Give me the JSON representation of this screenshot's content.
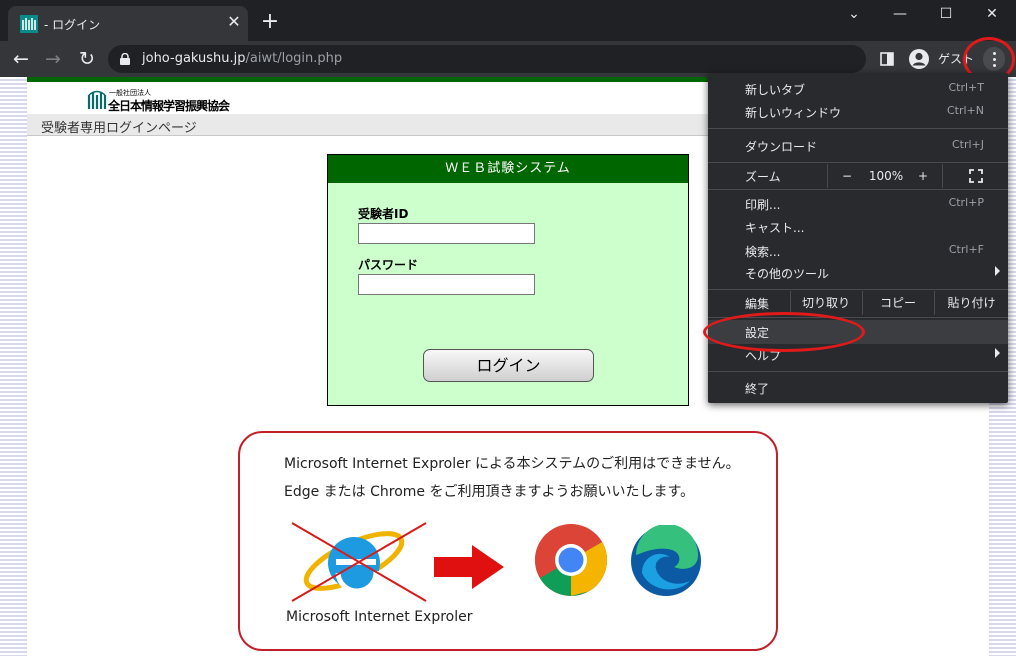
{
  "tab": {
    "title": "- ログイン",
    "close_glyph": "✕",
    "new_tab_glyph": "+"
  },
  "window_controls": {
    "minimize": "—",
    "maximize": "☐",
    "close": "✕",
    "dropdown": "⌄"
  },
  "toolbar": {
    "back_glyph": "←",
    "forward_glyph": "→",
    "reload_glyph": "↻",
    "url_domain": "joho-gakushu.jp",
    "url_path": "/aiwt/login.php",
    "profile_label": "ゲスト"
  },
  "page": {
    "logo_subtitle": "一般社団法人",
    "logo_text": "全日本情報学習振興協会",
    "subheader": "受験者専用ログインページ",
    "login": {
      "header": "ＷＥＢ試験システム",
      "id_label": "受験者ID",
      "password_label": "パスワード",
      "id_value": "",
      "password_value": "",
      "button_label": "ログイン"
    },
    "notice": {
      "line1": "Microsoft Internet Exproler による本システムのご利用はできません。",
      "line2": "Edge または Chrome をご利用頂きますようお願いいたします。",
      "ie_caption": "Microsoft Internet Exproler"
    }
  },
  "menu": {
    "new_tab": "新しいタブ",
    "new_tab_shortcut": "Ctrl+T",
    "new_window": "新しいウィンドウ",
    "new_window_shortcut": "Ctrl+N",
    "downloads": "ダウンロード",
    "downloads_shortcut": "Ctrl+J",
    "zoom": "ズーム",
    "zoom_minus": "−",
    "zoom_value": "100%",
    "zoom_plus": "+",
    "print": "印刷...",
    "print_shortcut": "Ctrl+P",
    "cast": "キャスト...",
    "find": "検索...",
    "find_shortcut": "Ctrl+F",
    "more_tools": "その他のツール",
    "edit": "編集",
    "cut": "切り取り",
    "copy": "コピー",
    "paste": "貼り付け",
    "settings": "設定",
    "help": "ヘルプ",
    "exit": "終了"
  },
  "colors": {
    "accent_red": "#e01a1a",
    "page_green": "#006600",
    "login_bg": "#ccffcc"
  }
}
